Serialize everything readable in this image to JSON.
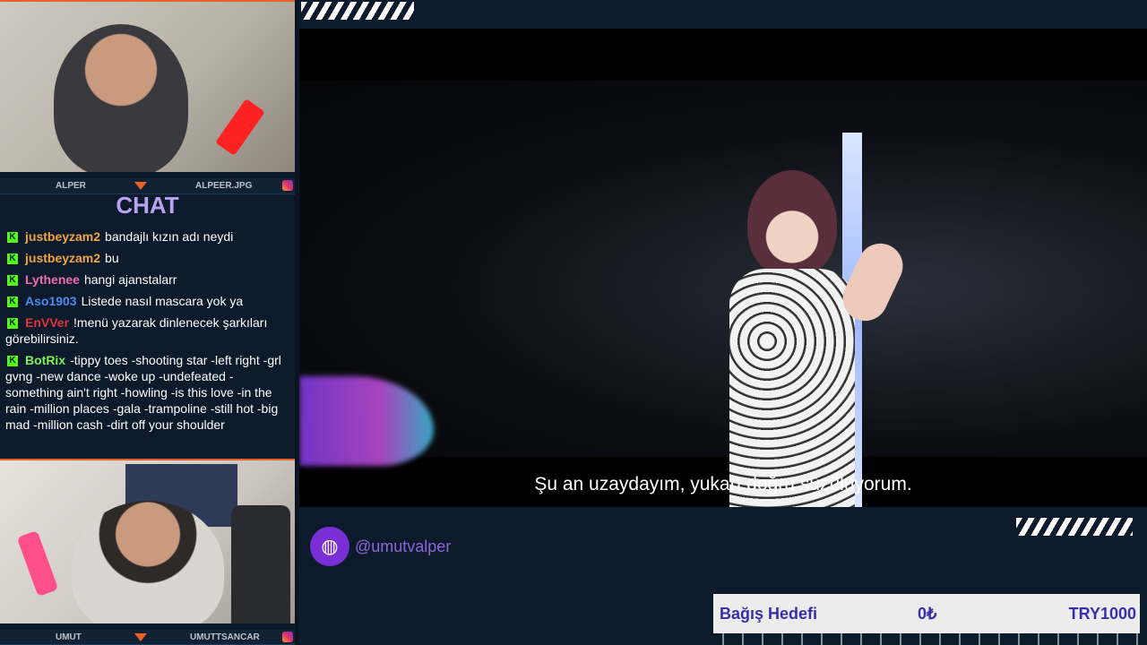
{
  "webcam_top": {
    "left_label": "ALPER",
    "right_label": "ALPEER.JPG"
  },
  "webcam_bottom": {
    "left_label": "UMUT",
    "right_label": "UMUTTSANCAR"
  },
  "chat": {
    "title": "CHAT",
    "messages": [
      {
        "user": "justbeyzam2",
        "user_color": "#f0a63c",
        "text": "bandajlı kızın adı neydi"
      },
      {
        "user": "justbeyzam2",
        "user_color": "#f0a63c",
        "text": "bu"
      },
      {
        "user": "Lythenee",
        "user_color": "#f06bb3",
        "text": "hangi ajanstalarr"
      },
      {
        "user": "Aso1903",
        "user_color": "#4a8cf0",
        "text": "Listede nasıl mascara yok ya"
      },
      {
        "user": "EnVVer",
        "user_color": "#e0343f",
        "text": "!menü yazarak dinlenecek şarkıları görebilirsiniz."
      },
      {
        "user": "BotRix",
        "user_color": "#7ef05a",
        "text": "-tippy toes -shooting star -left right -grl gvng -new dance -woke up -undefeated -something ain't right -howling -is this love -in the rain -million places -gala -trampoline -still hot -big mad -million cash -dirt off your shoulder"
      }
    ]
  },
  "video": {
    "subtitle": "Şu an uzaydayım, yukarı doğru süzülüyorum."
  },
  "social": {
    "handle": "@umutvalper",
    "icon": "globe-icon"
  },
  "donation": {
    "label": "Bağış Hedefi",
    "current": "0₺",
    "goal": "TRY1000"
  }
}
